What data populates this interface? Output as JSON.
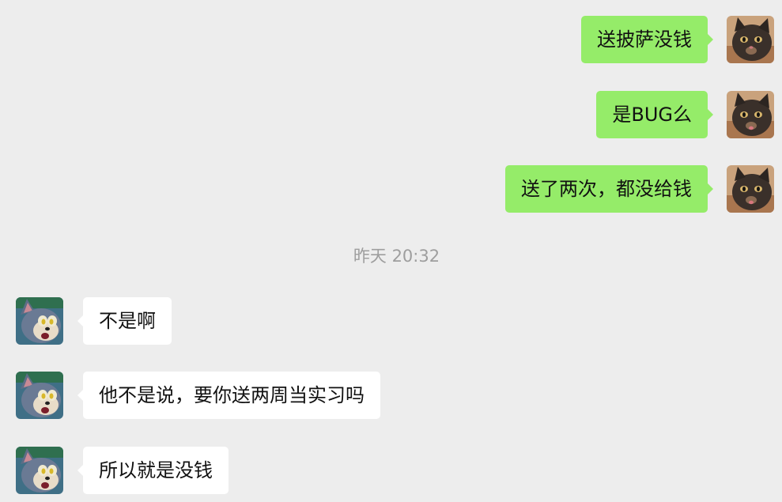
{
  "conversation": {
    "messages_before": [
      {
        "sender": "self",
        "avatar_icon": "cat-avatar-icon",
        "text": "送披萨没钱"
      },
      {
        "sender": "self",
        "avatar_icon": "cat-avatar-icon",
        "text": "是BUG么"
      },
      {
        "sender": "self",
        "avatar_icon": "cat-avatar-icon",
        "text": "送了两次，都没给钱"
      }
    ],
    "timestamp": "昨天 20:32",
    "messages_after": [
      {
        "sender": "other",
        "avatar_icon": "tom-cat-avatar-icon",
        "text": "不是啊"
      },
      {
        "sender": "other",
        "avatar_icon": "tom-cat-avatar-icon",
        "text": "他不是说，要你送两周当实习吗"
      },
      {
        "sender": "other",
        "avatar_icon": "tom-cat-avatar-icon",
        "text": "所以就是没钱"
      }
    ]
  },
  "colors": {
    "background": "#ededed",
    "outgoing_bubble": "#95ec69",
    "incoming_bubble": "#ffffff",
    "timestamp_text": "#9e9e9e",
    "message_text": "#111111"
  }
}
